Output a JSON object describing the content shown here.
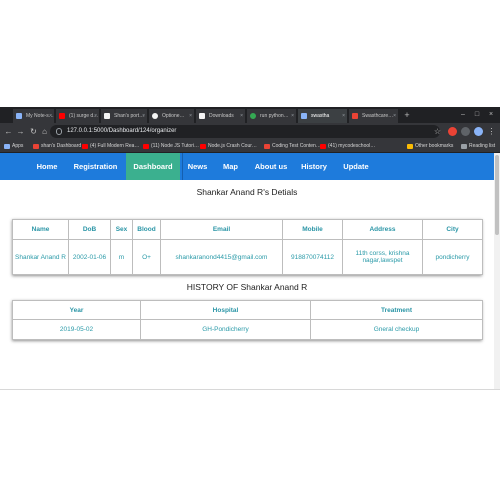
{
  "browser": {
    "tabs": [
      {
        "label": "My Note-s…",
        "color": "#8ab4f8"
      },
      {
        "label": "(1) surge d…",
        "color": "#ff0000"
      },
      {
        "label": "Shan's port…",
        "color": "#f4f4f4"
      },
      {
        "label": "Optione…",
        "color": "#f4f4f4"
      },
      {
        "label": "Downloads",
        "color": "#f4f4f4"
      },
      {
        "label": "run python…",
        "color": "#34a853"
      },
      {
        "label": "swastha",
        "color": "#8ab4f8"
      },
      {
        "label": "Swasthcare…",
        "color": "#ea4335"
      }
    ],
    "active_tab_index": 6,
    "url": "127.0.0.1:5000/Dashboard/124/organizer",
    "bookmarks": [
      {
        "label": "Apps",
        "color": "#8ab4f8"
      },
      {
        "label": "shan's Dashboard",
        "color": "#ea4335"
      },
      {
        "label": "(4) Full Modern Rea…",
        "color": "#ff0000"
      },
      {
        "label": "(11) Node JS Tutori…",
        "color": "#ff0000"
      },
      {
        "label": "Node.js Crash Cour…",
        "color": "#ff0000"
      },
      {
        "label": "Coding Test Conten…",
        "color": "#ea4335"
      },
      {
        "label": "(41) mycodeschool…",
        "color": "#ff0000"
      },
      {
        "label": "Other bookmarks",
        "color": "#fbbc04"
      },
      {
        "label": "Reading list",
        "color": "#9aa0a6"
      }
    ]
  },
  "nav": {
    "items": [
      "Home",
      "Registration",
      "Dashboard",
      "News",
      "Map",
      "About us",
      "History",
      "Update"
    ],
    "active_index": 2,
    "color": "#1e7bdc",
    "active_color": "#3bb08f"
  },
  "patient": {
    "heading": "Shankar Anand R's Detials",
    "columns": [
      "Name",
      "DoB",
      "Sex",
      "Blood",
      "Email",
      "Mobile",
      "Address",
      "City"
    ],
    "row": {
      "name": "Shankar Anand R",
      "dob": "2002-01-06",
      "sex": "m",
      "blood": "O+",
      "email": "shankaranond4415@gmail.com",
      "mobile": "918870074112",
      "address": "11th corss, krishna nagar,lawspet",
      "city": "pondicherry"
    }
  },
  "history": {
    "heading": "HISTORY OF Shankar Anand R",
    "columns": [
      "Year",
      "Hospital",
      "Treatment"
    ],
    "rows": [
      {
        "year": "2019-05-02",
        "hospital": "GH-Pondicherry",
        "treatment": "Gneral checkup"
      }
    ]
  }
}
